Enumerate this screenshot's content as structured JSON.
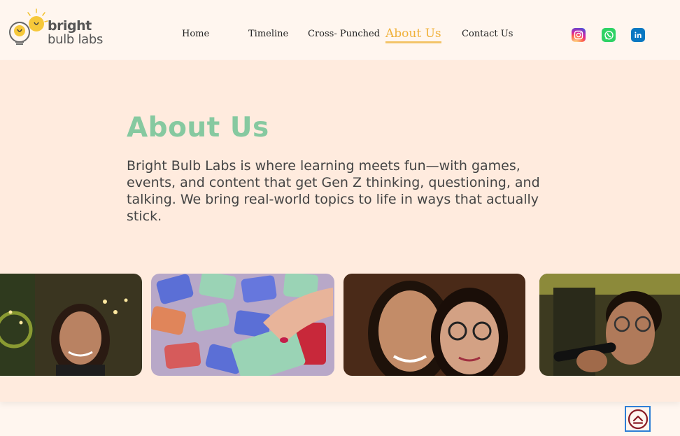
{
  "brand": {
    "word1": "bright",
    "word2": "bulb labs",
    "icon": "lightbulb-icon"
  },
  "nav": {
    "items": [
      {
        "label": "Home",
        "active": false
      },
      {
        "label": "Timeline",
        "active": false
      },
      {
        "label": "Cross- Punched",
        "active": false
      },
      {
        "label": "About Us",
        "active": true
      },
      {
        "label": "Contact Us",
        "active": false
      }
    ]
  },
  "social": [
    {
      "name": "instagram",
      "icon": "instagram-icon"
    },
    {
      "name": "whatsapp",
      "icon": "whatsapp-icon"
    },
    {
      "name": "linkedin",
      "icon": "linkedin-icon"
    }
  ],
  "about": {
    "title": "About Us",
    "description": "Bright Bulb Labs is where learning meets fun—with games, events, and content that get Gen Z thinking, questioning, and talking. We bring real-world topics to life in ways that actually stick."
  },
  "gallery": [
    {
      "alt": "photo-smiling-woman"
    },
    {
      "alt": "photo-card-game"
    },
    {
      "alt": "photo-two-women-selfie"
    },
    {
      "alt": "photo-man-with-microphone"
    }
  ],
  "colors": {
    "page_bg": "#fff6ef",
    "section_bg": "#ffebde",
    "title_green": "#86c9a0",
    "active_nav": "#f0b13a"
  },
  "scroll_top": {
    "icon": "chevron-up-circle-icon"
  }
}
